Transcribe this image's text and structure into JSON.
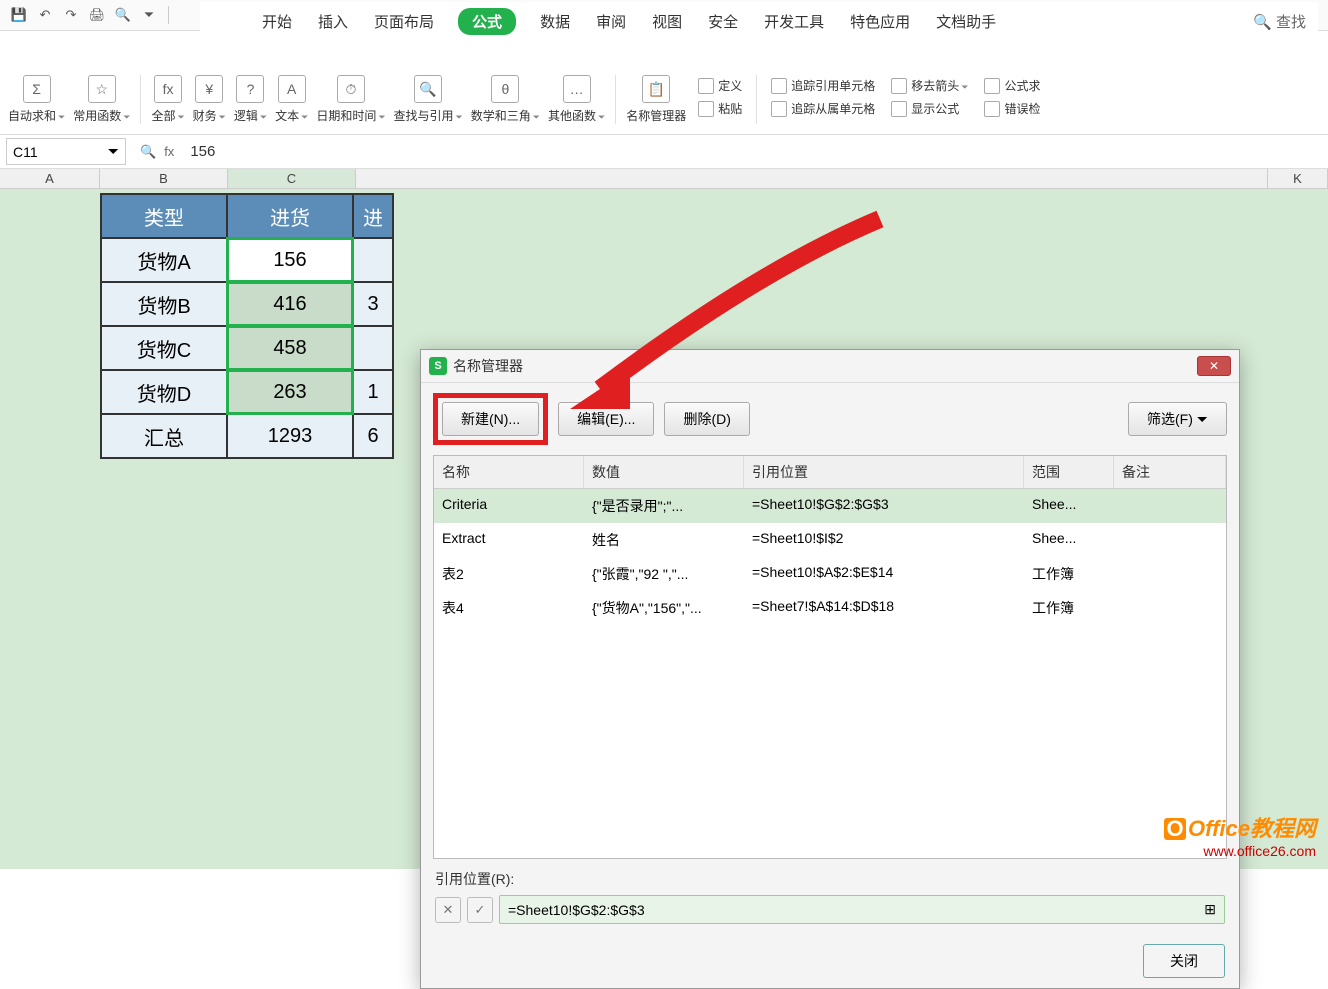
{
  "menus": {
    "items": [
      "开始",
      "插入",
      "页面布局",
      "公式",
      "数据",
      "审阅",
      "视图",
      "安全",
      "开发工具",
      "特色应用",
      "文档助手"
    ],
    "active": "公式",
    "search": "查找"
  },
  "ribbon": {
    "autosum": "自动求和",
    "common": "常用函数",
    "all": "全部",
    "finance": "财务",
    "logical": "逻辑",
    "text": "文本",
    "datetime": "日期和时间",
    "lookup": "查找与引用",
    "math": "数学和三角",
    "other": "其他函数",
    "namemgr": "名称管理器",
    "paste": "粘贴",
    "define": "定义",
    "trace_precedent": "追踪引用单元格",
    "trace_dependent": "追踪从属单元格",
    "remove_arrows": "移去箭头",
    "show_formula": "显示公式",
    "formula_expr": "公式求",
    "error_check": "错误检"
  },
  "formula_bar": {
    "cell_ref": "C11",
    "formula": "156"
  },
  "columns": [
    "A",
    "B",
    "C",
    "K"
  ],
  "table": {
    "headers": [
      "类型",
      "进货",
      "进"
    ],
    "rows": [
      {
        "type": "货物A",
        "qty": "156"
      },
      {
        "type": "货物B",
        "qty": "416"
      },
      {
        "type": "货物C",
        "qty": "458"
      },
      {
        "type": "货物D",
        "qty": "263"
      }
    ],
    "total_label": "汇总",
    "total_value": "1293"
  },
  "dialog": {
    "title": "名称管理器",
    "new_btn": "新建(N)...",
    "edit_btn": "编辑(E)...",
    "delete_btn": "删除(D)",
    "filter_btn": "筛选(F)",
    "headers": {
      "name": "名称",
      "value": "数值",
      "ref": "引用位置",
      "scope": "范围",
      "note": "备注"
    },
    "rows": [
      {
        "name": "Criteria",
        "value": "{\"是否录用\";\"...",
        "ref": "=Sheet10!$G$2:$G$3",
        "scope": "Shee..."
      },
      {
        "name": "Extract",
        "value": "姓名",
        "ref": "=Sheet10!$I$2",
        "scope": "Shee..."
      },
      {
        "name": "表2",
        "value": "{\"张霞\",\"92 \",\"...",
        "ref": "=Sheet10!$A$2:$E$14",
        "scope": "工作簿"
      },
      {
        "name": "表4",
        "value": "{\"货物A\",\"156\",\"...",
        "ref": "=Sheet7!$A$14:$D$18",
        "scope": "工作簿"
      }
    ],
    "ref_label": "引用位置(R):",
    "ref_value": "=Sheet10!$G$2:$G$3",
    "close": "关闭"
  },
  "watermark": {
    "line1": "Office教程网",
    "line2": "www.office26.com"
  }
}
